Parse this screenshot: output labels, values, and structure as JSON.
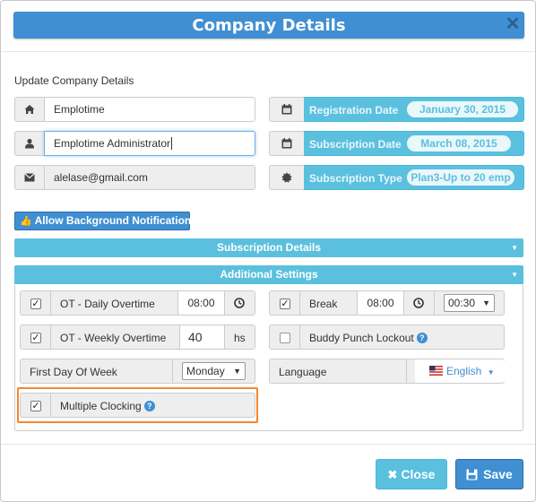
{
  "dialog": {
    "title": "Company Details",
    "close_icon": "close-icon",
    "section_label": "Update Company Details"
  },
  "fields": {
    "company_name": "Emplotime",
    "admin_name": "Emplotime Administrator",
    "email": "alelase@gmail.com"
  },
  "dates": {
    "registration_label": "Registration Date",
    "registration_value": "January 30, 2015",
    "subscription_label": "Subscription Date",
    "subscription_value": "March 08, 2015",
    "type_label": "Subscription Type",
    "type_value": "Plan3-Up to 20 emp"
  },
  "notifications_button": "Allow Background Notifications",
  "sections": {
    "subscription": "Subscription Details",
    "additional": "Additional Settings"
  },
  "settings": {
    "ot_daily": {
      "label": "OT - Daily Overtime",
      "value": "08:00",
      "checked": true
    },
    "break": {
      "label": "Break",
      "value": "08:00",
      "duration": "00:30",
      "checked": true
    },
    "ot_weekly": {
      "label": "OT - Weekly Overtime",
      "value": "40",
      "unit": "hs",
      "checked": true
    },
    "buddy_punch": {
      "label": "Buddy Punch Lockout",
      "checked": false
    },
    "first_day": {
      "label": "First Day Of Week",
      "value": "Monday"
    },
    "language": {
      "label": "Language",
      "value": "English"
    },
    "multiple_clocking": {
      "label": "Multiple Clocking",
      "checked": true
    }
  },
  "footer": {
    "close_label": "Close",
    "save_label": "Save"
  },
  "colors": {
    "primary": "#3f8fd2",
    "info": "#5bc0de",
    "highlight": "#f5872f"
  }
}
